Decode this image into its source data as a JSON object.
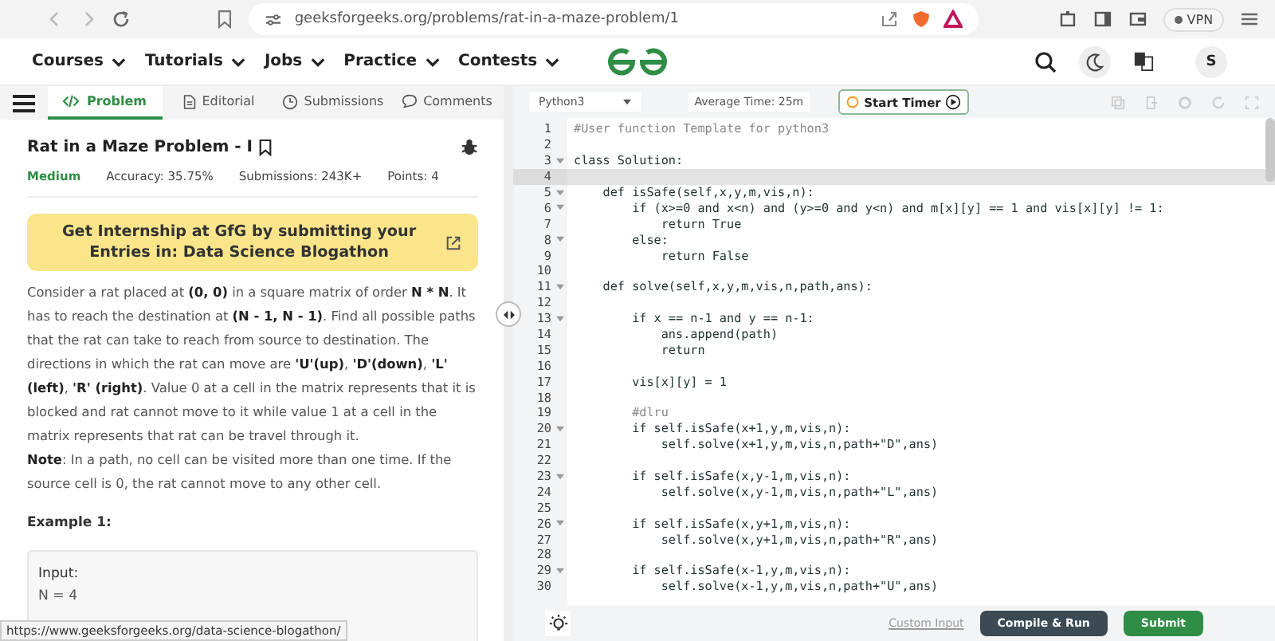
{
  "browser": {
    "url": "geeksforgeeks.org/problems/rat-in-a-maze-problem/1",
    "vpn": "VPN"
  },
  "nav": {
    "items": [
      "Courses",
      "Tutorials",
      "Jobs",
      "Practice",
      "Contests"
    ],
    "avatar": "S"
  },
  "tabs": [
    {
      "label": "Problem",
      "selected": true
    },
    {
      "label": "Editorial",
      "selected": false
    },
    {
      "label": "Submissions",
      "selected": false
    },
    {
      "label": "Comments",
      "selected": false
    }
  ],
  "problem": {
    "title": "Rat in a Maze Problem - I",
    "difficulty": "Medium",
    "accuracy": "Accuracy: 35.75%",
    "submissions": "Submissions: 243K+",
    "points": "Points: 4",
    "banner": "Get Internship at GfG by submitting your Entries in: Data Science Blogathon",
    "description": "Consider a rat placed at **(0, 0)** in a square matrix of order **N * N**. It has to reach the destination at **(N - 1, N - 1)**. Find all possible paths that the rat can take to reach from source to destination. The directions in which the rat can move are **'U'(up)**, **'D'(down)**, **'L' (left)**, **'R' (right)**. Value 0 at a cell in the matrix represents that it is blocked and rat cannot move to it while value 1 at a cell in the matrix represents that rat can be travel through it.",
    "note": "**Note**: In a path, no cell can be visited more than one time. If the source cell is 0, the rat cannot move to any other cell.",
    "example_title": "Example 1:",
    "example_lines": [
      "Input:",
      "N = 4"
    ]
  },
  "status_url": "https://www.geeksforgeeks.org/data-science-blogathon/",
  "editor": {
    "language": "Python3",
    "average_time": "Average Time: 25m",
    "timer_button": "Start Timer",
    "lines": [
      {
        "number": "1",
        "code": "#User function Template for python3",
        "kind": "comment",
        "fold": false,
        "active": false
      },
      {
        "number": "2",
        "fold": false,
        "active": false
      },
      {
        "number": "3",
        "code": "class Solution:",
        "kind": "code",
        "fold": true,
        "active": false
      },
      {
        "number": "4",
        "fold": false,
        "active": true
      },
      {
        "number": "5",
        "code": "    def isSafe(self,x,y,m,vis,n):",
        "kind": "code",
        "fold": true,
        "active": false
      },
      {
        "number": "6",
        "code": "        if (x>=0 and x<n) and (y>=0 and y<n) and m[x][y] == 1 and vis[x][y] != 1:",
        "kind": "code",
        "fold": true,
        "active": false
      },
      {
        "number": "7",
        "code": "            return True",
        "kind": "code",
        "fold": false,
        "active": false
      },
      {
        "number": "8",
        "code": "        else:",
        "kind": "code",
        "fold": true,
        "active": false
      },
      {
        "number": "9",
        "code": "            return False",
        "kind": "code",
        "fold": false,
        "active": false
      },
      {
        "number": "10",
        "fold": false,
        "active": false
      },
      {
        "number": "11",
        "code": "    def solve(self,x,y,m,vis,n,path,ans):",
        "kind": "code",
        "fold": true,
        "active": false
      },
      {
        "number": "12",
        "fold": false,
        "active": false
      },
      {
        "number": "13",
        "code": "        if x == n-1 and y == n-1:",
        "kind": "code",
        "fold": true,
        "active": false
      },
      {
        "number": "14",
        "code": "            ans.append(path)",
        "kind": "code",
        "fold": false,
        "active": false
      },
      {
        "number": "15",
        "code": "            return",
        "kind": "code",
        "fold": false,
        "active": false
      },
      {
        "number": "16",
        "fold": false,
        "active": false
      },
      {
        "number": "17",
        "code": "        vis[x][y] = 1",
        "kind": "code",
        "fold": false,
        "active": false
      },
      {
        "number": "18",
        "fold": false,
        "active": false
      },
      {
        "number": "19",
        "code": "        #dlru",
        "kind": "comment",
        "fold": false,
        "active": false
      },
      {
        "number": "20",
        "code": "        if self.isSafe(x+1,y,m,vis,n):",
        "kind": "code",
        "fold": true,
        "active": false
      },
      {
        "number": "21",
        "code": "            self.solve(x+1,y,m,vis,n,path+\"D\",ans)",
        "kind": "code",
        "fold": false,
        "active": false
      },
      {
        "number": "22",
        "fold": false,
        "active": false
      },
      {
        "number": "23",
        "code": "        if self.isSafe(x,y-1,m,vis,n):",
        "kind": "code",
        "fold": true,
        "active": false
      },
      {
        "number": "24",
        "code": "            self.solve(x,y-1,m,vis,n,path+\"L\",ans)",
        "kind": "code",
        "fold": false,
        "active": false
      },
      {
        "number": "25",
        "fold": false,
        "active": false
      },
      {
        "number": "26",
        "code": "        if self.isSafe(x,y+1,m,vis,n):",
        "kind": "code",
        "fold": true,
        "active": false
      },
      {
        "number": "27",
        "code": "            self.solve(x,y+1,m,vis,n,path+\"R\",ans)",
        "kind": "code",
        "fold": false,
        "active": false
      },
      {
        "number": "28",
        "fold": false,
        "active": false
      },
      {
        "number": "29",
        "code": "        if self.isSafe(x-1,y,m,vis,n):",
        "kind": "code",
        "fold": true,
        "active": false
      },
      {
        "number": "30",
        "code": "            self.solve(x-1,y,m,vis,n,path+\"U\",ans)",
        "kind": "code",
        "fold": false,
        "active": false
      }
    ],
    "custom_input": "Custom Input",
    "compile_button": "Compile & Run",
    "submit_button": "Submit"
  }
}
